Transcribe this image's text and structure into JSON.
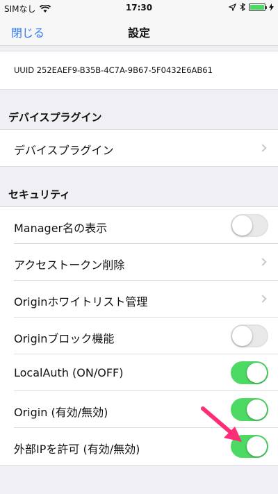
{
  "status_bar": {
    "carrier": "SIMなし",
    "time": "17:30"
  },
  "nav": {
    "back_label": "閉じる",
    "title": "設定"
  },
  "uuid_row": {
    "text": "UUID 252EAEF9-B35B-4C7A-9B67-5F0432E6AB61"
  },
  "sections": {
    "device_plugin": {
      "header": "デバイスプラグイン",
      "item": "デバイスプラグイン"
    },
    "security": {
      "header": "セキュリティ",
      "items": [
        {
          "label": "Manager名の表示",
          "control": "toggle",
          "on": false
        },
        {
          "label": "アクセストークン削除",
          "control": "chevron"
        },
        {
          "label": "Originホワイトリスト管理",
          "control": "chevron"
        },
        {
          "label": "Originブロック機能",
          "control": "toggle",
          "on": false
        },
        {
          "label": "LocalAuth (ON/OFF)",
          "control": "toggle",
          "on": true
        },
        {
          "label": "Origin (有効/無効)",
          "control": "toggle",
          "on": true
        },
        {
          "label": "外部IPを許可 (有効/無効)",
          "control": "toggle",
          "on": true
        }
      ]
    }
  },
  "colors": {
    "accent": "#3478f6",
    "toggle_on": "#4cd964",
    "arrow": "#ff2d78"
  }
}
